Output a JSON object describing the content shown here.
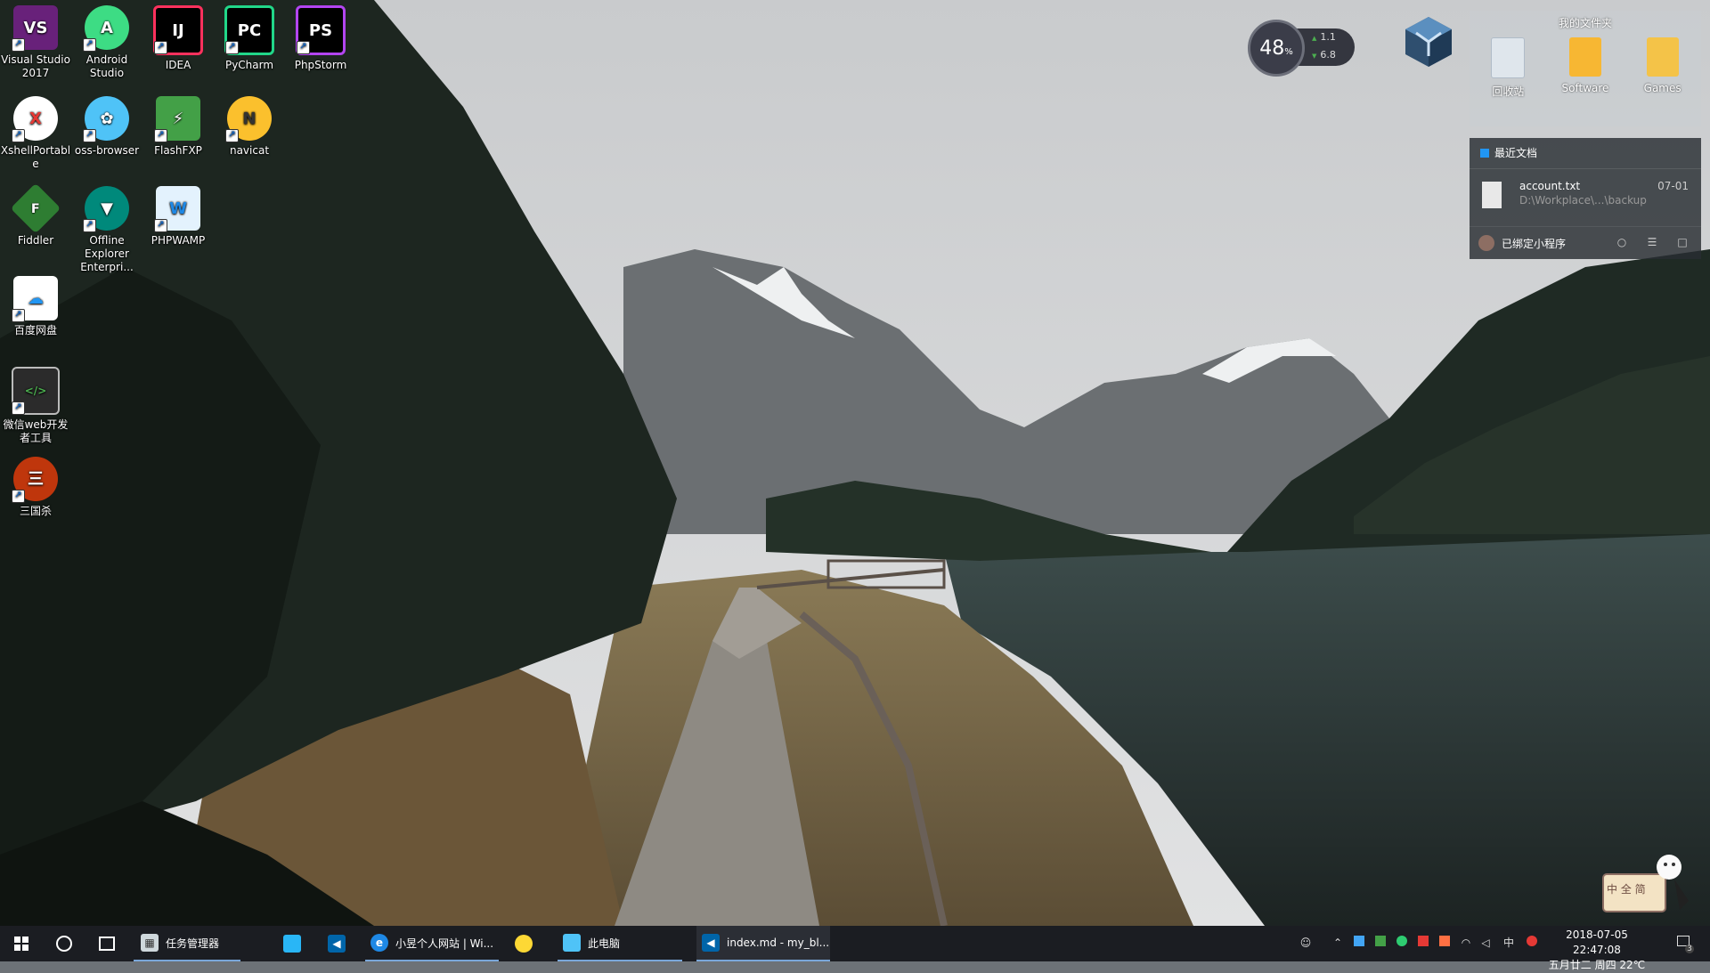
{
  "desktop_icons": [
    {
      "label": "Visual Studio 2017",
      "icon": "visual-studio-icon",
      "color": "#68217a"
    },
    {
      "label": "Android Studio",
      "icon": "android-studio-icon",
      "color": "#3ddc84"
    },
    {
      "label": "IDEA",
      "icon": "intellij-idea-icon",
      "color": "#fe315d"
    },
    {
      "label": "PyCharm",
      "icon": "pycharm-icon",
      "color": "#21d789"
    },
    {
      "label": "PhpStorm",
      "icon": "phpstorm-icon",
      "color": "#b345f1"
    },
    {
      "label": "XshellPortable",
      "icon": "xshell-icon",
      "color": "#e53935"
    },
    {
      "label": "oss-browser",
      "icon": "oss-browser-icon",
      "color": "#4fc3f7"
    },
    {
      "label": "FlashFXP",
      "icon": "flashfxp-icon",
      "color": "#43a047"
    },
    {
      "label": "navicat",
      "icon": "navicat-icon",
      "color": "#fbc02d"
    },
    {
      "label": "Fiddler",
      "icon": "fiddler-icon",
      "color": "#2e7d32"
    },
    {
      "label": "Offline Explorer Enterpri...",
      "icon": "offline-explorer-icon",
      "color": "#00897b"
    },
    {
      "label": "PHPWAMP",
      "icon": "phpwamp-icon",
      "color": "#1e88e5"
    },
    {
      "label": "百度网盘",
      "icon": "baidu-netdisk-icon",
      "color": "#2196f3"
    },
    {
      "label": "微信web开发者工具",
      "icon": "wechat-devtools-icon",
      "color": "#2b2b2b"
    },
    {
      "label": "三国杀",
      "icon": "sanguosha-icon",
      "color": "#bf360c"
    }
  ],
  "glyphs": {
    "vs": "VS",
    "android": "A",
    "idea": "IJ",
    "pycharm": "PC",
    "phpstorm": "PS",
    "xshell": "X",
    "oss": "✿",
    "flashfxp": "⚡",
    "navicat": "N",
    "fiddler": "F",
    "offline": "▼",
    "phpwamp": "W",
    "baidu": "☁",
    "wechat": "</>",
    "sgs": "三",
    "shortcut_arrow": "↗"
  },
  "net_widget": {
    "percent": "48",
    "percent_unit": "%",
    "up": "1.1",
    "down": "6.8"
  },
  "folders_panel": {
    "title": "我的文件夹",
    "items": [
      {
        "label": "回收站",
        "icon": "recycle-bin-icon"
      },
      {
        "label": "Software",
        "icon": "folder-icon"
      },
      {
        "label": "Games",
        "icon": "folder-icon"
      }
    ]
  },
  "recent_panel": {
    "header": "最近文档",
    "file_name": "account.txt",
    "file_path": "D:\\Workplace\\...\\backup",
    "file_date": "07-01",
    "footer_text": "已绑定小程序"
  },
  "ime": {
    "text": "中 全 简"
  },
  "taskbar": {
    "apps": [
      {
        "label": "任务管理器",
        "icon": "task-manager-icon"
      },
      {
        "label": "",
        "icon": "file-explorer-pin-icon"
      },
      {
        "label": "",
        "icon": "vscode-pin-icon"
      },
      {
        "label": "小昱个人网站 | Wi...",
        "icon": "browser-icon"
      },
      {
        "label": "",
        "icon": "yellow-app-icon"
      },
      {
        "label": "此电脑",
        "icon": "this-pc-icon"
      },
      {
        "label": "index.md - my_bl...",
        "icon": "vscode-icon"
      }
    ],
    "tray_input_lang": "中",
    "clock_line1": "2018-07-05  22:47:08",
    "clock_line2": "五月廿二 周四 22℃",
    "notification_count": "3"
  }
}
